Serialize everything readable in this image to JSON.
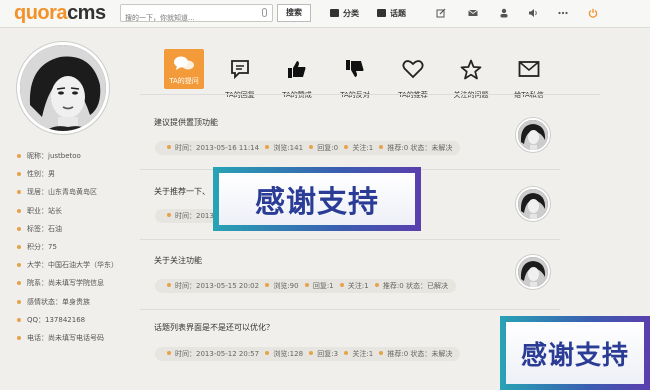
{
  "header": {
    "logo_part1": "quora",
    "logo_part2": "cms",
    "search_placeholder": "搜的一下，你就知道...",
    "search_button": "搜索",
    "nav": [
      {
        "label": "分类",
        "icon": "category-icon"
      },
      {
        "label": "话题",
        "icon": "topic-icon"
      }
    ],
    "toolbar_icons": [
      "edit-icon",
      "mail-icon",
      "user-icon",
      "sound-icon",
      "more-icon",
      "power-icon"
    ],
    "accent_color": "#f3922a"
  },
  "profile": {
    "items": [
      "昵称：justbetoo",
      "性别：男",
      "现居：山东青岛黄岛区",
      "职业：站长",
      "标签：石油",
      "积分：75",
      "大学：中国石油大学（华东）",
      "院系：尚未填写学院信息",
      "感情状态：单身贵族",
      "QQ：137842168",
      "电话：尚未填写电话号码"
    ]
  },
  "tabs": [
    {
      "label": "TA的提问",
      "icon": "speech-bubbles-icon",
      "active": true
    },
    {
      "label": "TA的回复",
      "icon": "comment-icon",
      "active": false
    },
    {
      "label": "TA的赞成",
      "icon": "thumbs-up-icon",
      "active": false
    },
    {
      "label": "TA的反对",
      "icon": "thumbs-down-icon",
      "active": false
    },
    {
      "label": "TA的推荐",
      "icon": "heart-icon",
      "active": false
    },
    {
      "label": "关注的问题",
      "icon": "star-icon",
      "active": false
    },
    {
      "label": "给TA私信",
      "icon": "envelope-icon",
      "active": false
    }
  ],
  "questions": [
    {
      "title": "建议提供置顶功能",
      "meta": [
        "时间：2013-05-16 11:14",
        "浏览:141",
        "回复:0",
        "关注:1",
        "推荐:0 状态：未解决"
      ]
    },
    {
      "title": "关于推荐一下、",
      "meta": [
        "时间：2013-0"
      ]
    },
    {
      "title": "关于关注功能",
      "meta": [
        "时间：2013-05-15 20:02",
        "浏览:90",
        "回复:1",
        "关注:1",
        "推荐:0 状态：已解决"
      ]
    },
    {
      "title": "话题列表界面是不是还可以优化？",
      "meta": [
        "时间：2013-05-12 20:57",
        "浏览:128",
        "回复:3",
        "关注:1",
        "推荐:0 状态：未解决"
      ]
    }
  ],
  "banners": [
    {
      "text": "感谢支持"
    },
    {
      "text": "感谢支持"
    }
  ]
}
